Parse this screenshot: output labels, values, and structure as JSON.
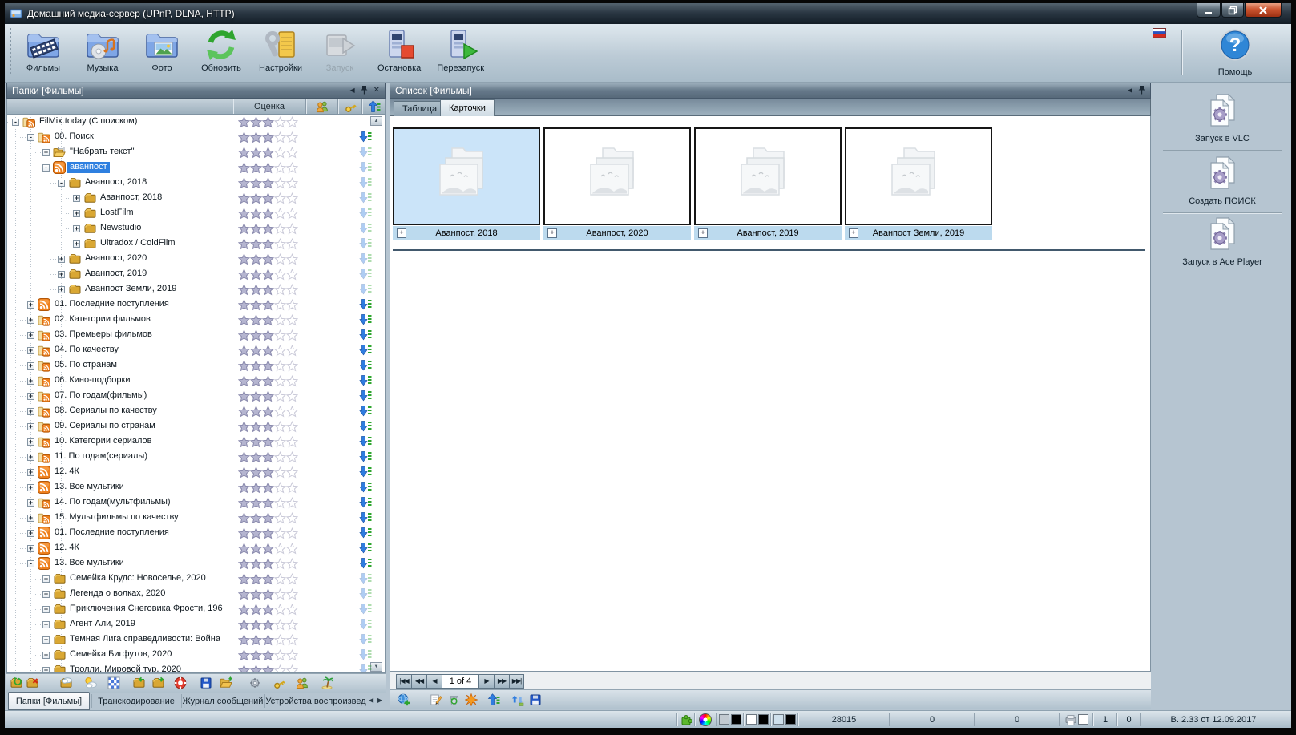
{
  "window": {
    "title": "Домашний медиа-сервер (UPnP, DLNA, HTTP)"
  },
  "toolbar": {
    "buttons": [
      {
        "id": "films",
        "label": "Фильмы",
        "disabled": false
      },
      {
        "id": "music",
        "label": "Музыка",
        "disabled": false
      },
      {
        "id": "photo",
        "label": "Фото",
        "disabled": false
      },
      {
        "id": "refresh",
        "label": "Обновить",
        "disabled": false
      },
      {
        "id": "settings",
        "label": "Настройки",
        "disabled": false
      },
      {
        "id": "start",
        "label": "Запуск",
        "disabled": true
      },
      {
        "id": "stop",
        "label": "Остановка",
        "disabled": false
      },
      {
        "id": "restart",
        "label": "Перезапуск",
        "disabled": false
      }
    ],
    "help_label": "Помощь"
  },
  "folders_panel": {
    "title": "Папки [Фильмы]",
    "rating_header": "Оценка",
    "tree": [
      {
        "label": "FilMix.today (С поиском)",
        "level": 0,
        "expander": "minus",
        "icon": "folder-rss",
        "stars": 3,
        "arrow": "none",
        "selected": false
      },
      {
        "label": "00. Поиск",
        "level": 1,
        "expander": "minus",
        "icon": "folder-rss",
        "stars": 3,
        "arrow": "bright",
        "selected": false
      },
      {
        "label": "\"Набрать текст\"",
        "level": 2,
        "expander": "plus",
        "icon": "folder-doc",
        "stars": 3,
        "arrow": "faded",
        "selected": false
      },
      {
        "label": "аванпост",
        "level": 2,
        "expander": "minus",
        "icon": "rss",
        "stars": 3,
        "arrow": "faded",
        "selected": true
      },
      {
        "label": "Аванпост, 2018",
        "level": 3,
        "expander": "minus",
        "icon": "gold-folder",
        "stars": 3,
        "arrow": "faded",
        "selected": false
      },
      {
        "label": "Аванпост, 2018",
        "level": 4,
        "expander": "plus",
        "icon": "gold-folder",
        "stars": 3,
        "arrow": "faded",
        "selected": false
      },
      {
        "label": "LostFilm",
        "level": 4,
        "expander": "plus",
        "icon": "gold-folder",
        "stars": 3,
        "arrow": "faded",
        "selected": false
      },
      {
        "label": "Newstudio",
        "level": 4,
        "expander": "plus",
        "icon": "gold-folder",
        "stars": 3,
        "arrow": "faded",
        "selected": false
      },
      {
        "label": "Ultradox / ColdFilm",
        "level": 4,
        "expander": "plus",
        "icon": "gold-folder",
        "stars": 3,
        "arrow": "faded",
        "selected": false
      },
      {
        "label": "Аванпост, 2020",
        "level": 3,
        "expander": "plus",
        "icon": "gold-folder",
        "stars": 3,
        "arrow": "faded",
        "selected": false
      },
      {
        "label": "Аванпост, 2019",
        "level": 3,
        "expander": "plus",
        "icon": "gold-folder",
        "stars": 3,
        "arrow": "faded",
        "selected": false
      },
      {
        "label": "Аванпост Земли, 2019",
        "level": 3,
        "expander": "plus",
        "icon": "gold-folder",
        "stars": 3,
        "arrow": "faded",
        "selected": false
      },
      {
        "label": "01. Последние поступления",
        "level": 1,
        "expander": "plus",
        "icon": "rss",
        "stars": 3,
        "arrow": "bright",
        "selected": false
      },
      {
        "label": "02. Категории фильмов",
        "level": 1,
        "expander": "plus",
        "icon": "folder-rss",
        "stars": 3,
        "arrow": "bright",
        "selected": false
      },
      {
        "label": "03. Премьеры фильмов",
        "level": 1,
        "expander": "plus",
        "icon": "folder-rss",
        "stars": 3,
        "arrow": "bright",
        "selected": false
      },
      {
        "label": "04. По качеству",
        "level": 1,
        "expander": "plus",
        "icon": "folder-rss",
        "stars": 3,
        "arrow": "bright",
        "selected": false
      },
      {
        "label": "05. По странам",
        "level": 1,
        "expander": "plus",
        "icon": "folder-rss",
        "stars": 3,
        "arrow": "bright",
        "selected": false
      },
      {
        "label": "06. Кино-подборки",
        "level": 1,
        "expander": "plus",
        "icon": "folder-rss",
        "stars": 3,
        "arrow": "bright",
        "selected": false
      },
      {
        "label": "07. По годам(фильмы)",
        "level": 1,
        "expander": "plus",
        "icon": "folder-rss",
        "stars": 3,
        "arrow": "bright",
        "selected": false
      },
      {
        "label": "08. Сериалы по качеству",
        "level": 1,
        "expander": "plus",
        "icon": "folder-rss",
        "stars": 3,
        "arrow": "bright",
        "selected": false
      },
      {
        "label": "09. Сериалы по странам",
        "level": 1,
        "expander": "plus",
        "icon": "folder-rss",
        "stars": 3,
        "arrow": "bright",
        "selected": false
      },
      {
        "label": "10. Категории сериалов",
        "level": 1,
        "expander": "plus",
        "icon": "folder-rss",
        "stars": 3,
        "arrow": "bright",
        "selected": false
      },
      {
        "label": "11. По годам(сериалы)",
        "level": 1,
        "expander": "plus",
        "icon": "folder-rss",
        "stars": 3,
        "arrow": "bright",
        "selected": false
      },
      {
        "label": "12. 4К",
        "level": 1,
        "expander": "plus",
        "icon": "rss",
        "stars": 3,
        "arrow": "bright",
        "selected": false
      },
      {
        "label": "13. Все мультики",
        "level": 1,
        "expander": "plus",
        "icon": "rss",
        "stars": 3,
        "arrow": "bright",
        "selected": false
      },
      {
        "label": "14. По годам(мультфильмы)",
        "level": 1,
        "expander": "plus",
        "icon": "folder-rss",
        "stars": 3,
        "arrow": "bright",
        "selected": false
      },
      {
        "label": "15. Мультфильмы по качеству",
        "level": 1,
        "expander": "plus",
        "icon": "folder-rss",
        "stars": 3,
        "arrow": "bright",
        "selected": false
      },
      {
        "label": "01. Последние поступления",
        "level": 1,
        "expander": "plus",
        "icon": "rss",
        "stars": 3,
        "arrow": "bright",
        "selected": false
      },
      {
        "label": "12. 4К",
        "level": 1,
        "expander": "plus",
        "icon": "rss",
        "stars": 3,
        "arrow": "bright",
        "selected": false
      },
      {
        "label": "13. Все мультики",
        "level": 1,
        "expander": "minus",
        "icon": "rss",
        "stars": 3,
        "arrow": "bright",
        "selected": false
      },
      {
        "label": "Семейка Крудс: Новоселье, 2020",
        "level": 2,
        "expander": "plus",
        "icon": "gold-folder",
        "stars": 3,
        "arrow": "faded",
        "selected": false
      },
      {
        "label": "Легенда о волках, 2020",
        "level": 2,
        "expander": "plus",
        "icon": "gold-folder",
        "stars": 3,
        "arrow": "faded",
        "selected": false
      },
      {
        "label": "Приключения Снеговика Фрости, 196",
        "level": 2,
        "expander": "plus",
        "icon": "gold-folder",
        "stars": 3,
        "arrow": "faded",
        "selected": false
      },
      {
        "label": "Агент Али, 2019",
        "level": 2,
        "expander": "plus",
        "icon": "gold-folder",
        "stars": 3,
        "arrow": "faded",
        "selected": false
      },
      {
        "label": "Темная Лига справедливости: Война",
        "level": 2,
        "expander": "plus",
        "icon": "gold-folder",
        "stars": 3,
        "arrow": "faded",
        "selected": false
      },
      {
        "label": "Семейка Бигфутов, 2020",
        "level": 2,
        "expander": "plus",
        "icon": "gold-folder",
        "stars": 3,
        "arrow": "faded",
        "selected": false
      },
      {
        "label": "Тролли. Мировой тур, 2020",
        "level": 2,
        "expander": "plus",
        "icon": "gold-folder",
        "stars": 3,
        "arrow": "faded",
        "selected": false
      }
    ],
    "toolbar_icons": [
      "folder-sync",
      "folder-delete",
      "folder-cloud",
      "weather",
      "mosaic",
      "folder-import",
      "folder-export",
      "lifebuoy",
      "save",
      "folder-open",
      "gear",
      "key",
      "users",
      "palm"
    ],
    "tabs": [
      {
        "label": "Папки [Фильмы]",
        "active": true
      },
      {
        "label": "Транскодирование",
        "active": false
      },
      {
        "label": "Журнал сообщений",
        "active": false
      },
      {
        "label": "Устройства воспроизвед",
        "active": false
      }
    ]
  },
  "list_panel": {
    "title": "Список [Фильмы]",
    "view_tabs": [
      {
        "label": "Таблица",
        "active": false
      },
      {
        "label": "Карточки",
        "active": true
      }
    ],
    "cards": [
      {
        "label": "Аванпост, 2018",
        "selected": true
      },
      {
        "label": "Аванпост, 2020",
        "selected": false
      },
      {
        "label": "Аванпост, 2019",
        "selected": false
      },
      {
        "label": "Аванпост Земли, 2019",
        "selected": false
      }
    ],
    "pagination": "1 of 4",
    "toolbar_icons": [
      "web-new",
      "edit",
      "recycle",
      "burst",
      "upload-list",
      "media-transfer",
      "save"
    ]
  },
  "actions_panel": {
    "buttons": [
      {
        "id": "vlc-launch",
        "label": "Запуск в VLC"
      },
      {
        "id": "create-search",
        "label": "Создать ПОИСК"
      },
      {
        "id": "ace-player-launch",
        "label": "Запуск в Ace Player"
      }
    ]
  },
  "status_bar": {
    "files_count": "28015",
    "counter_2": "0",
    "counter_3": "0",
    "device_count_1": "1",
    "device_count_2": "0",
    "version": "В. 2.33 от 12.09.2017"
  },
  "colors": {
    "selection": "#2f80e0",
    "rss_orange": "#ee7f1c",
    "card_selected": "#cbe4f9",
    "caption_bg": "#bcdaee"
  }
}
